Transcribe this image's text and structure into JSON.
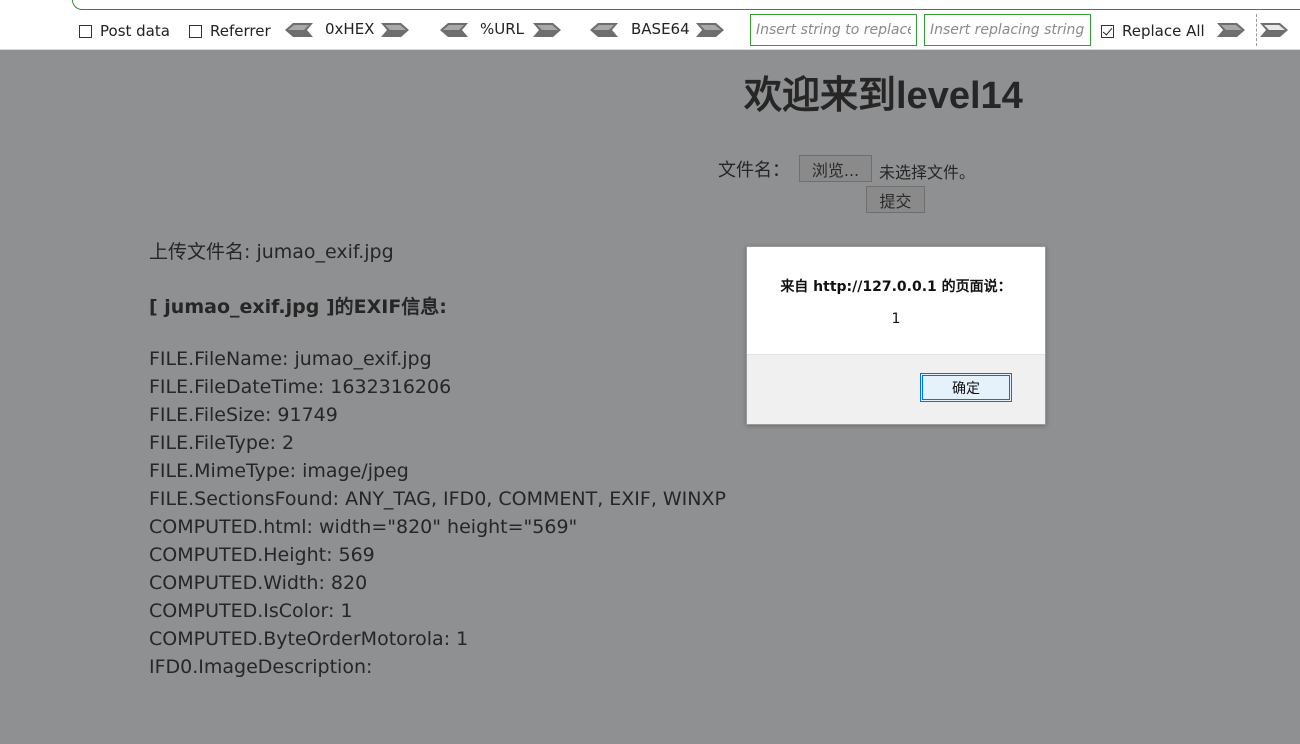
{
  "toolbar": {
    "post_data_label": "Post data",
    "post_data_checked": false,
    "referrer_label": "Referrer",
    "referrer_checked": false,
    "hex_label": "0xHEX",
    "url_label": "%URL",
    "base64_label": "BASE64",
    "replace_from_placeholder": "Insert string to replace",
    "replace_to_placeholder": "Insert replacing string",
    "replace_all_label": "Replace All",
    "replace_all_checked": true,
    "accent_color": "#3a9a3a"
  },
  "page": {
    "title": "欢迎来到level14",
    "file_label": "文件名：",
    "browse_label": "浏览...",
    "file_status": "未选择文件。",
    "submit_label": "提交",
    "upload_name": "上传文件名: jumao_exif.jpg",
    "exif_heading": "[ jumao_exif.jpg ]的EXIF信息:",
    "exif_lines": [
      "FILE.FileName: jumao_exif.jpg",
      "FILE.FileDateTime: 1632316206",
      "FILE.FileSize: 91749",
      "FILE.FileType: 2",
      "FILE.MimeType: image/jpeg",
      "FILE.SectionsFound: ANY_TAG, IFD0, COMMENT, EXIF, WINXP",
      "COMPUTED.html: width=\"820\" height=\"569\"",
      "COMPUTED.Height: 569",
      "COMPUTED.Width: 820",
      "COMPUTED.IsColor: 1",
      "COMPUTED.ByteOrderMotorola: 1",
      "IFD0.ImageDescription:"
    ],
    "background_color": "#8f9091"
  },
  "dialog": {
    "origin": "来自 http://127.0.0.1 的页面说：",
    "message": "1",
    "ok_label": "确定"
  }
}
